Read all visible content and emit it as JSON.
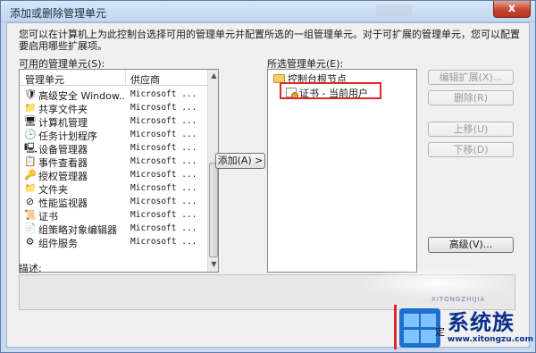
{
  "window": {
    "title": "添加或删除管理单元",
    "close_glyph": "x"
  },
  "intro": "您可以在计算机上为此控制台选择可用的管理单元并配置所选的一组管理单元。对于可扩展的管理单元，您可以配置要启用哪些扩展项。",
  "available": {
    "label": "可用的管理单元(S):",
    "col_name": "管理单元",
    "col_vendor": "供应商",
    "items": [
      {
        "icon": "shield-icon",
        "glyph": "🛡",
        "name": "高级安全 Window...",
        "vendor": "Microsoft ..."
      },
      {
        "icon": "folder-share-icon",
        "glyph": "📁",
        "name": "共享文件夹",
        "vendor": "Microsoft ..."
      },
      {
        "icon": "computer-management-icon",
        "glyph": "🖥",
        "name": "计算机管理",
        "vendor": "Microsoft ..."
      },
      {
        "icon": "clock-icon",
        "glyph": "🕒",
        "name": "任务计划程序",
        "vendor": "Microsoft ..."
      },
      {
        "icon": "device-manager-icon",
        "glyph": "🖳",
        "name": "设备管理器",
        "vendor": "Microsoft ..."
      },
      {
        "icon": "event-viewer-icon",
        "glyph": "📋",
        "name": "事件查看器",
        "vendor": "Microsoft ..."
      },
      {
        "icon": "authorization-icon",
        "glyph": "🔑",
        "name": "授权管理器",
        "vendor": "Microsoft ..."
      },
      {
        "icon": "folder-icon",
        "glyph": "📁",
        "name": "文件夹",
        "vendor": "Microsoft ..."
      },
      {
        "icon": "performance-icon",
        "glyph": "⊘",
        "name": "性能监视器",
        "vendor": "Microsoft ..."
      },
      {
        "icon": "certificate-icon",
        "glyph": "📜",
        "name": "证书",
        "vendor": "Microsoft ..."
      },
      {
        "icon": "group-policy-icon",
        "glyph": "📄",
        "name": "组策略对象编辑器",
        "vendor": "Microsoft ..."
      },
      {
        "icon": "component-services-icon",
        "glyph": "⚙",
        "name": "组件服务",
        "vendor": "Microsoft ..."
      }
    ]
  },
  "add_button": "添加(A) >",
  "selected": {
    "label": "所选管理单元(E):",
    "root": "控制台根节点",
    "child": "证书 - 当前用户"
  },
  "buttons": {
    "edit_extensions": "编辑扩展(X)...",
    "remove": "删除(R)",
    "move_up": "上移(U)",
    "move_down": "下移(D)",
    "advanced": "高级(V)..."
  },
  "description_label": "描述:",
  "watermark": {
    "small_text": "XITONGZHIJIA",
    "brand": "系统族",
    "url": "www.xitongzu.com",
    "ok_partial": "定"
  }
}
